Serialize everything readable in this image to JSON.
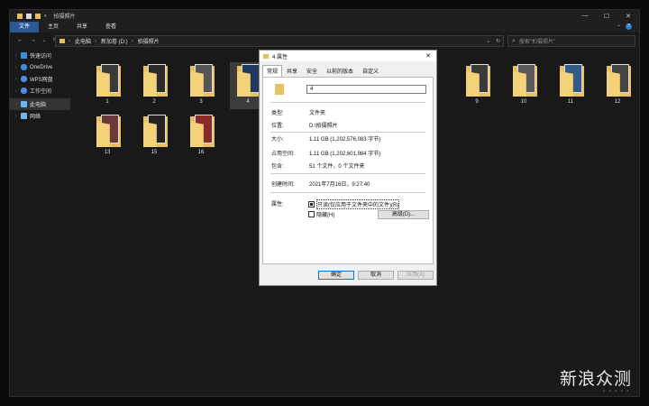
{
  "window": {
    "title": "拍摄照片",
    "controls": [
      "—",
      "☐",
      "✕"
    ]
  },
  "ribbon": {
    "tabs": [
      "文件",
      "主页",
      "共享",
      "查看"
    ],
    "active": "文件",
    "help": "?"
  },
  "address": {
    "crumbs": [
      "此电脑",
      "新加卷 (D:)",
      "拍摄照片"
    ],
    "search_placeholder": "搜索\"拍摄照片\""
  },
  "sidebar": {
    "items": [
      {
        "label": "快速访问",
        "icon": "star-icon",
        "color": "#3b8ede"
      },
      {
        "label": "OneDrive",
        "icon": "cloud-icon",
        "color": "#3b8ede"
      },
      {
        "label": "WPS网盘",
        "icon": "cloud-icon",
        "color": "#4c8be8"
      },
      {
        "label": "工作空间",
        "icon": "cloud-icon",
        "color": "#4c8be8"
      },
      {
        "label": "此电脑",
        "icon": "computer-icon",
        "color": "#6fb6f0",
        "selected": true
      },
      {
        "label": "网络",
        "icon": "network-icon",
        "color": "#6fb6f0"
      }
    ]
  },
  "folders": [
    "1",
    "2",
    "3",
    "4",
    "9",
    "10",
    "11",
    "12",
    "13",
    "15",
    "16"
  ],
  "selected_folder": "4",
  "dialog": {
    "title": "4 属性",
    "tabs": [
      "常规",
      "共享",
      "安全",
      "以前的版本",
      "自定义"
    ],
    "active_tab": "常规",
    "name": "4",
    "type_label": "类型:",
    "type_value": "文件夹",
    "location_label": "位置:",
    "location_value": "D:\\拍摄照片",
    "size_label": "大小:",
    "size_value": "1.11 GB (1,202,576,083 字节)",
    "disk_label": "占用空间:",
    "disk_value": "1.11 GB (1,202,601,984 字节)",
    "contains_label": "包含:",
    "contains_value": "51 个文件，0 个文件夹",
    "created_label": "创建时间:",
    "created_value": "2021年7月16日，9:27:40",
    "attr_label": "属性:",
    "readonly_label": "只读(仅应用于文件夹中的文件)(R)",
    "hidden_label": "隐藏(H)",
    "advanced_button": "高级(D)...",
    "ok": "确定",
    "cancel": "取消",
    "apply": "应用(A)"
  },
  "watermark": {
    "text": "新浪众测",
    "dots": "• • • • •"
  }
}
